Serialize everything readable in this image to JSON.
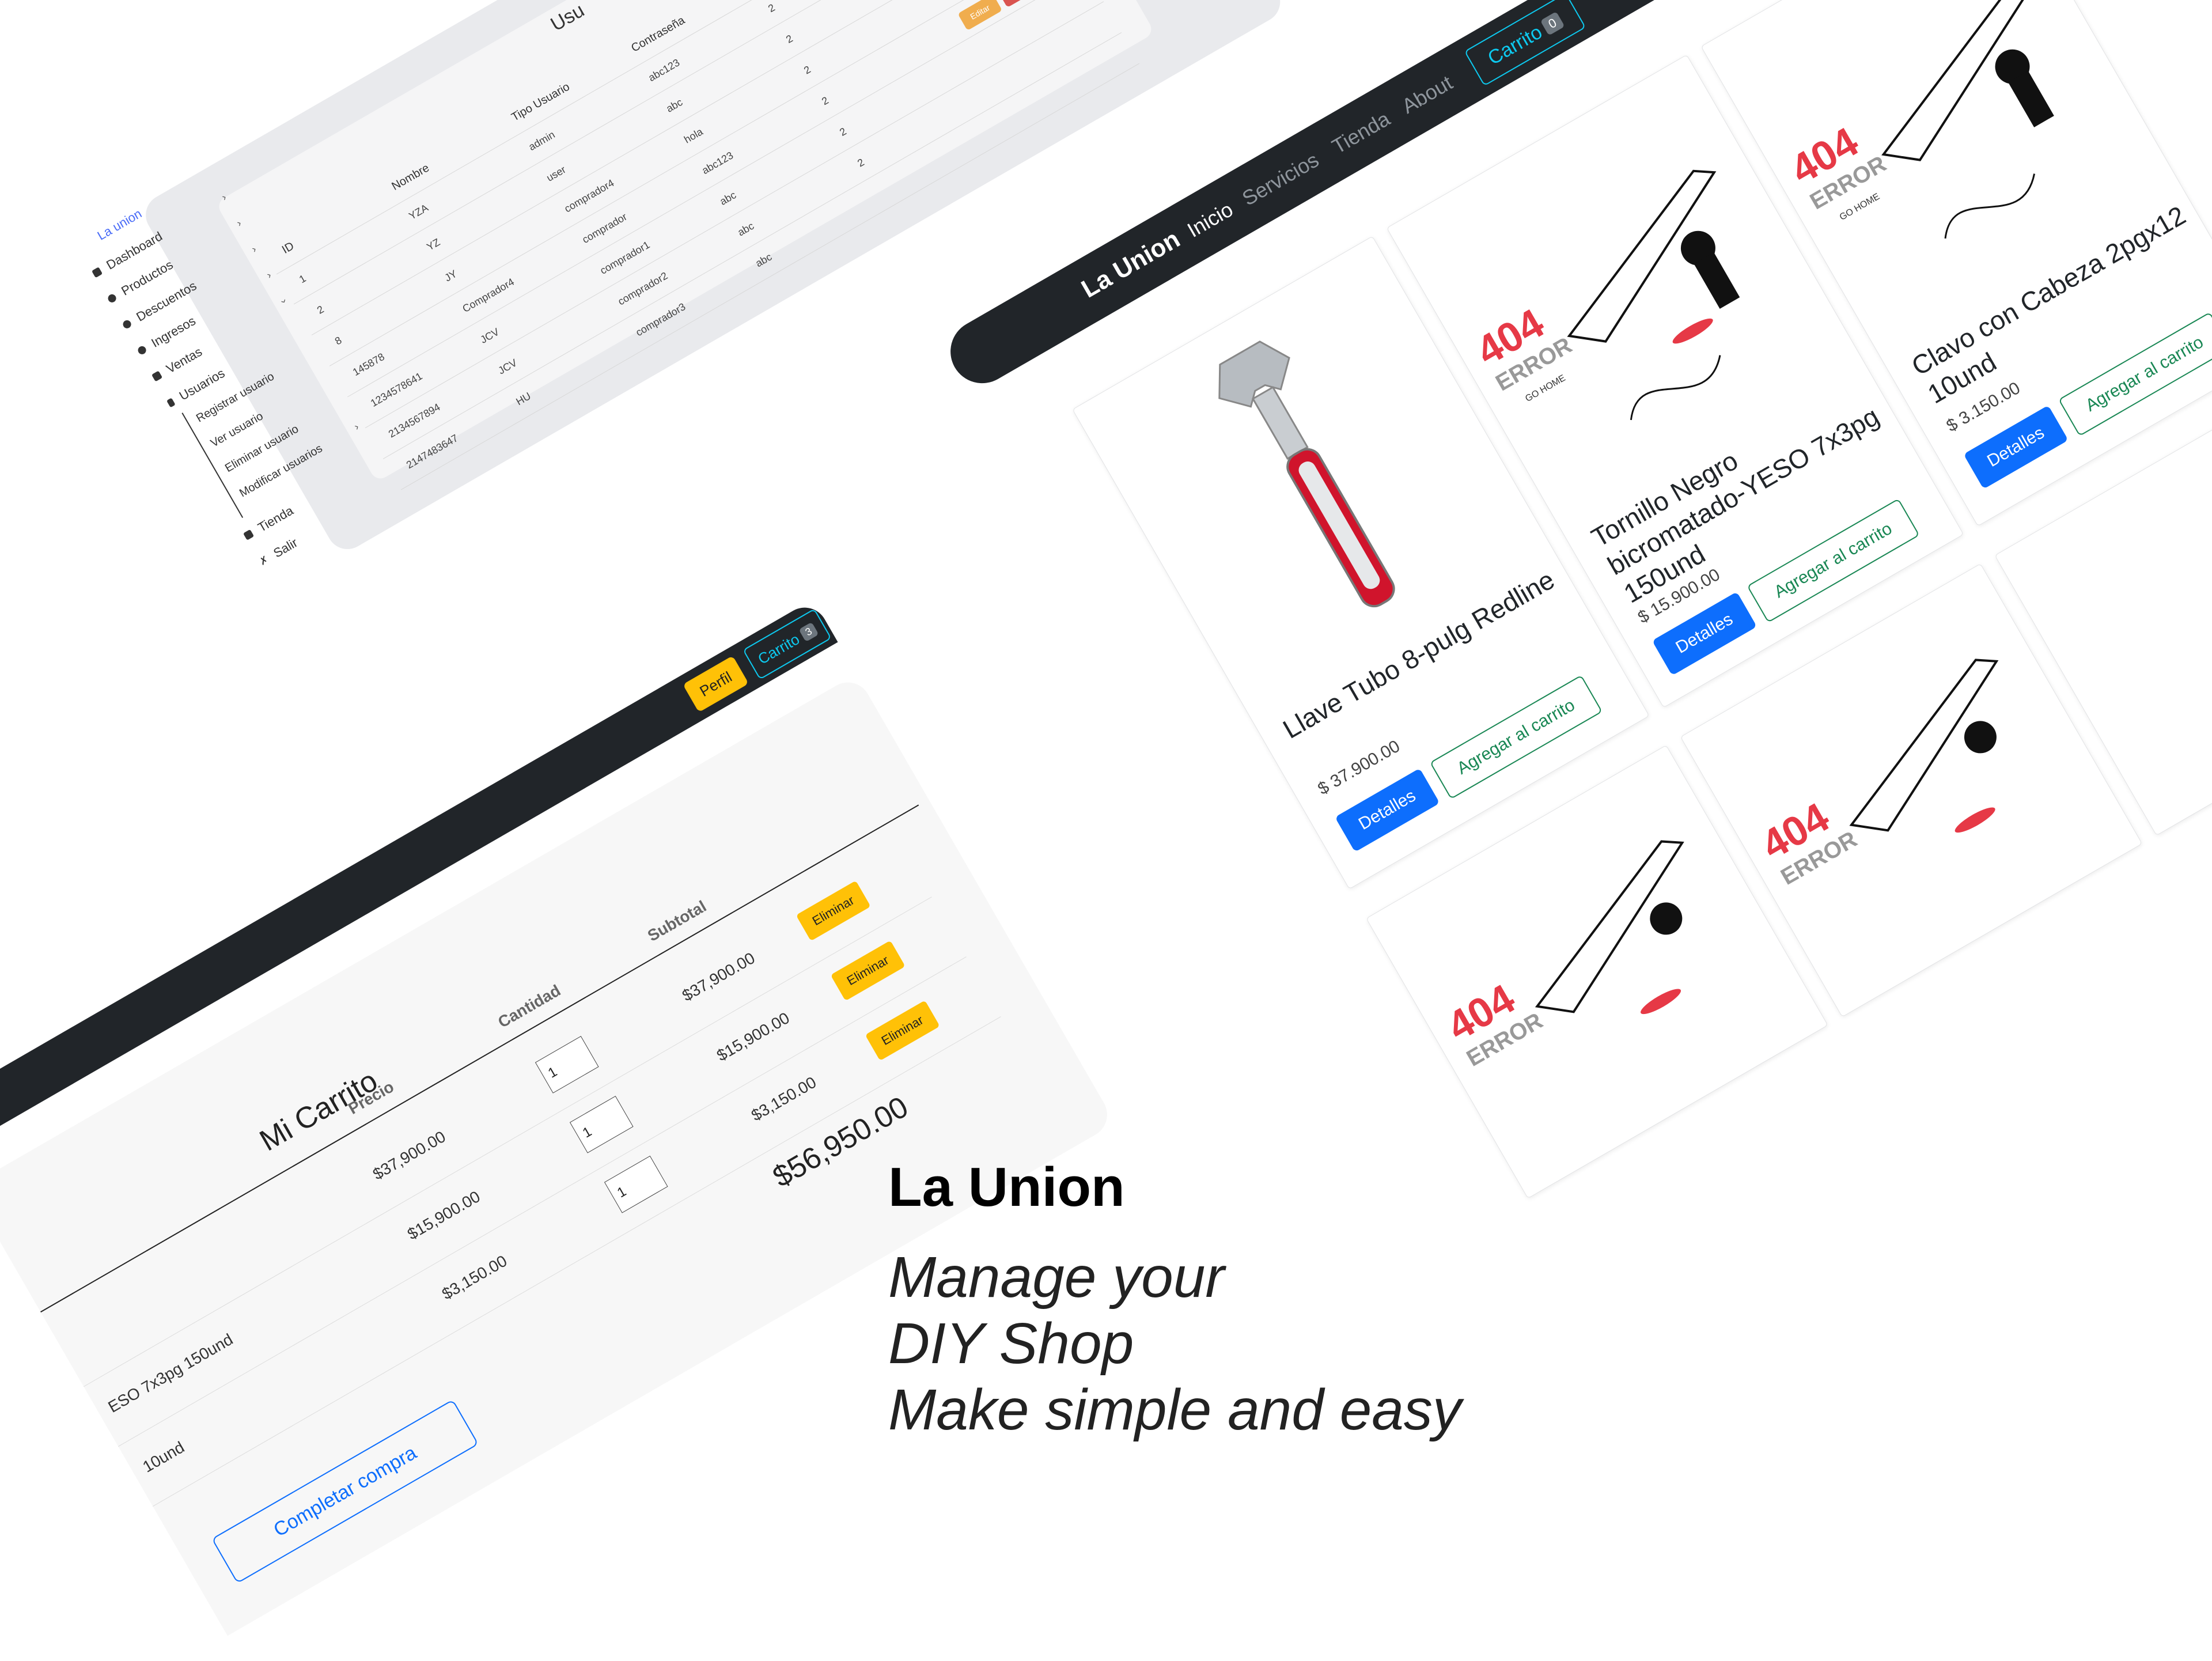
{
  "admin": {
    "heading": "Usu",
    "columns": [
      "ID",
      "Nombre",
      "Tipo Usuario",
      "Contraseña"
    ],
    "rows": [
      {
        "id": "1",
        "nombre": "YZA",
        "tipo": "admin",
        "pass": "abc123"
      },
      {
        "id": "2",
        "nombre": "YZ",
        "tipo": "user",
        "pass": "abc"
      },
      {
        "id": "8",
        "nombre": "JY",
        "tipo": "comprador4",
        "pass": "hola"
      },
      {
        "id": "145878",
        "nombre": "Comprador4",
        "tipo": "comprador",
        "pass": "abc123"
      },
      {
        "id": "1234578641",
        "nombre": "JCV",
        "tipo": "comprador1",
        "pass": "abc"
      },
      {
        "id": "2134567894",
        "nombre": "JCV",
        "tipo": "comprador2",
        "pass": "abc"
      },
      {
        "id": "2147483647",
        "nombre": "HU",
        "tipo": "comprador3",
        "pass": "abc"
      }
    ],
    "extra_values": [
      "2",
      "2",
      "2",
      "2",
      "2",
      "2"
    ],
    "edit_label": "Editar",
    "delete_label": "Eliminar"
  },
  "sidebar": {
    "brand": "La union",
    "items": [
      {
        "label": "Dashboard"
      },
      {
        "label": "Productos"
      },
      {
        "label": "Descuentos"
      },
      {
        "label": "Ingresos"
      },
      {
        "label": "Ventas"
      },
      {
        "label": "Usuarios"
      }
    ],
    "subitems": [
      "Registrar usuario",
      "Ver usuario",
      "Eliminar usuario",
      "Modificar usuarios"
    ],
    "tienda": "Tienda",
    "salir": "Salir"
  },
  "cart": {
    "perfil": "Perfil",
    "carrito": "Carrito",
    "badge": "3",
    "title": "Mi Carrito",
    "headers": {
      "precio": "Precio",
      "cantidad": "Cantidad",
      "subtotal": "Subtotal"
    },
    "rows": [
      {
        "name": "",
        "precio": "$37,900.00",
        "qty": "1",
        "subtotal": "$37,900.00"
      },
      {
        "name": "ESO 7x3pg 150und",
        "precio": "$15,900.00",
        "qty": "1",
        "subtotal": "$15,900.00"
      },
      {
        "name": "10und",
        "precio": "$3,150.00",
        "qty": "1",
        "subtotal": "$3,150.00"
      }
    ],
    "remove_label": "Eliminar",
    "total": "$56,950.00",
    "checkout": "Completar compra"
  },
  "store": {
    "brand": "La Union",
    "links": [
      "Inicio",
      "Servicios",
      "Tienda",
      "About"
    ],
    "carrito": "Carrito",
    "badge": "0",
    "products": [
      {
        "title": "Llave Tubo 8-pulg Redline",
        "price": "$ 37.900.00"
      },
      {
        "title": "Tornillo Negro bicromatado-YESO 7x3pg 150und",
        "price": "$ 15.900.00"
      },
      {
        "title": "Clavo con Cabeza 2pgx12 10und",
        "price": "$ 3.150.00"
      }
    ],
    "details_label": "Detalles",
    "add_label": "Agregar al carrito",
    "error_code": "404",
    "error_word": "ERROR",
    "go_home": "GO HOME"
  },
  "hero": {
    "title": "La Union",
    "line1": "Manage your",
    "line2": "DIY Shop",
    "line3": "Make simple and easy"
  }
}
